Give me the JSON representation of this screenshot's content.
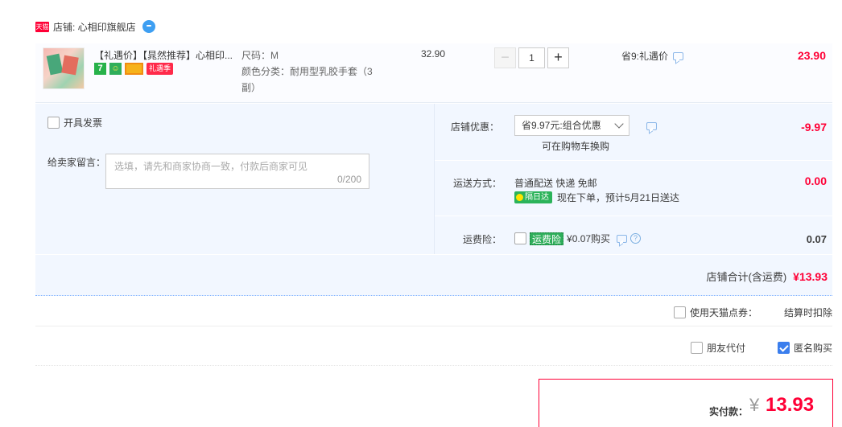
{
  "shop": {
    "label": "店铺: 心相印旗舰店",
    "tmall_badge": "天猫"
  },
  "item": {
    "title": "【礼遇价】【晁然推荐】心相印...",
    "badge_seven": "7",
    "badge_shield": "☺",
    "badge_gift": "礼遇季",
    "sku_size": "尺码：M",
    "sku_color": "颜色分类：耐用型乳胶手套（3副）",
    "price": "32.90",
    "quantity": "1",
    "minus": "−",
    "plus": "+",
    "save_label": "省9:礼遇价",
    "total": "23.90"
  },
  "options": {
    "invoice_label": "开具发票",
    "memo_label": "给卖家留言：",
    "memo_placeholder": "选填，请先和商家协商一致，付款后商家可见",
    "memo_count": "0/200",
    "discount_label": "店铺优惠：",
    "discount_value": "省9.97元:组合优惠",
    "discount_note": "可在购物车换购",
    "discount_amount": "-9.97",
    "shipping_label": "运送方式：",
    "shipping_method": "普通配送 快递 免邮",
    "shipping_tag": "隔日达",
    "shipping_eta": "现在下单，预计5月21日送达",
    "shipping_amount": "0.00",
    "insurance_label": "运费险：",
    "insurance_tag": "运费险",
    "insurance_price": "¥0.07购买",
    "insurance_help": "?",
    "insurance_amount": "0.07"
  },
  "subtotal": {
    "label": "店铺合计(含运费)",
    "amount": "¥13.93"
  },
  "points": {
    "label": "使用天猫点券：",
    "deduct": "结算时扣除"
  },
  "payment": {
    "friend_label": "朋友代付",
    "anon_label": "匿名购买",
    "anon_checked": true
  },
  "final": {
    "label": "实付款：",
    "currency": "¥",
    "amount": "13.93"
  },
  "colors": {
    "accent": "#ff0036",
    "panel": "#f2f7ff",
    "check": "#3b7eed"
  }
}
